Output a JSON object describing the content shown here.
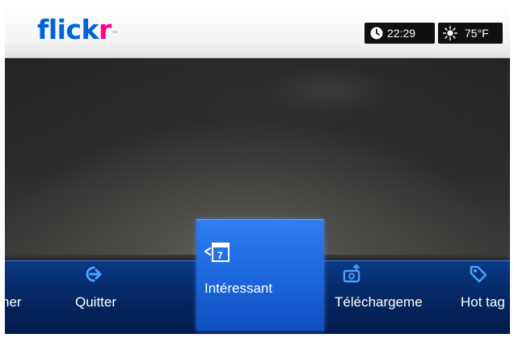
{
  "app": {
    "logo_part1": "flick",
    "logo_part2": "r",
    "logo_tm": "™"
  },
  "status": {
    "time": "22:29",
    "temperature": "75°F"
  },
  "menu": {
    "items": [
      {
        "label": "her",
        "icon": "search-icon"
      },
      {
        "label": "Quitter",
        "icon": "exit-arrow-icon"
      },
      {
        "label": "Intéressant",
        "icon": "calendar-7-icon",
        "selected": true
      },
      {
        "label": "Téléchargeme",
        "icon": "upload-camera-icon"
      },
      {
        "label": "Hot tag",
        "icon": "tag-icon"
      }
    ]
  },
  "colors": {
    "brand_blue": "#0063dc",
    "brand_pink": "#ff0084",
    "menu_bar": "#062a68",
    "selected_tile": "#1e6ae0"
  }
}
